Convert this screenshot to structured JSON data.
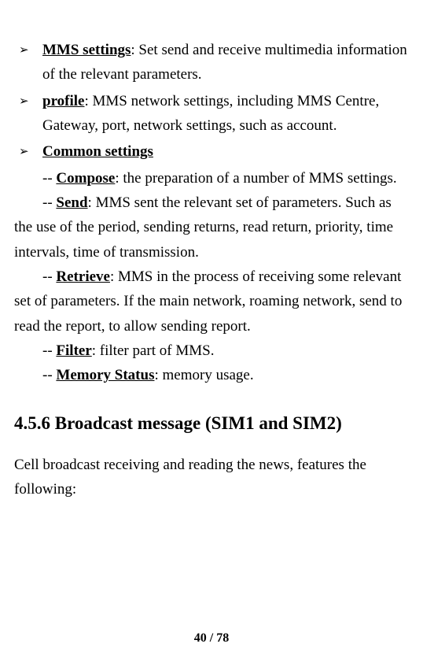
{
  "bullets": {
    "item1": {
      "term": "MMS settings",
      "desc": ": Set send and receive multimedia information of the relevant parameters."
    },
    "item2": {
      "term": "profile",
      "desc": ": MMS network settings, including MMS Centre, Gateway, port, network settings, such as account."
    },
    "item3": {
      "term": "Common settings"
    }
  },
  "sub": {
    "compose": {
      "prefix": "-- ",
      "term": "Compose",
      "desc": ": the preparation of a number of MMS settings."
    },
    "send": {
      "prefix": "-- ",
      "term": "Send",
      "desc": ": MMS sent the relevant set of parameters. Such as the use of the period, sending returns, read return, priority, time intervals, time of transmission."
    },
    "retrieve": {
      "prefix": "-- ",
      "term": "Retrieve",
      "desc": ": MMS in the process of receiving some relevant set of parameters. If the main network, roaming network, send to read the report, to allow sending report."
    },
    "filter": {
      "prefix": "-- ",
      "term": "Filter",
      "desc": ": filter part of MMS."
    },
    "memory": {
      "prefix": "-- ",
      "term": "Memory Status",
      "desc": ": memory usage."
    }
  },
  "section": {
    "heading": "4.5.6 Broadcast message (SIM1 and SIM2)",
    "body": "Cell broadcast receiving and reading the news, features the following:"
  },
  "pagenum": "40 / 78"
}
